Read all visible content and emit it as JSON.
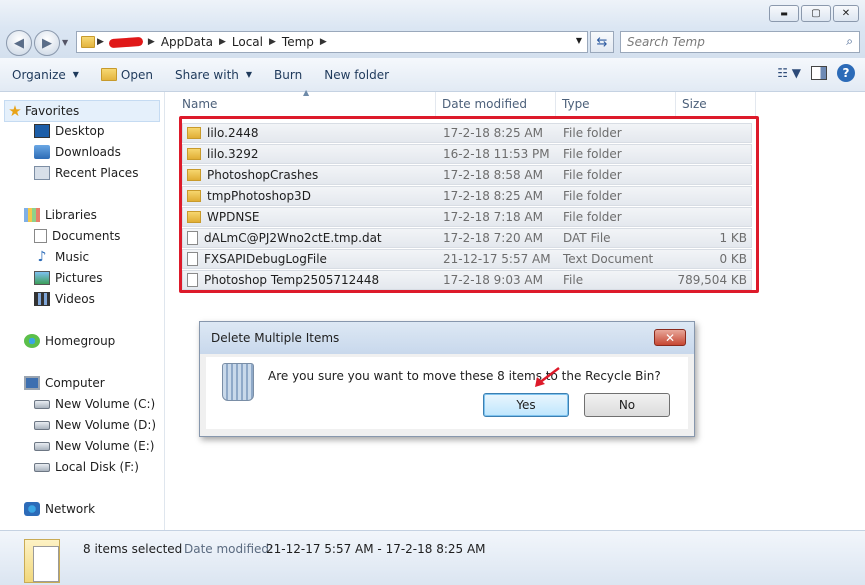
{
  "window": {
    "minimize": "▬",
    "maximize": "▢",
    "close": "✕"
  },
  "address": {
    "crumbs": [
      "AppData",
      "Local",
      "Temp"
    ],
    "search_placeholder": "Search Temp"
  },
  "toolbar": {
    "organize": "Organize",
    "open": "Open",
    "share_with": "Share with",
    "burn": "Burn",
    "new_folder": "New folder"
  },
  "nav": {
    "favorites": "Favorites",
    "desktop": "Desktop",
    "downloads": "Downloads",
    "recent_places": "Recent Places",
    "libraries": "Libraries",
    "documents": "Documents",
    "music": "Music",
    "pictures": "Pictures",
    "videos": "Videos",
    "homegroup": "Homegroup",
    "computer": "Computer",
    "drive_c": "New Volume (C:)",
    "drive_d": "New Volume (D:)",
    "drive_e": "New Volume (E:)",
    "drive_f": "Local Disk (F:)",
    "network": "Network"
  },
  "columns": {
    "name": "Name",
    "date": "Date modified",
    "type": "Type",
    "size": "Size"
  },
  "files": [
    {
      "name": "lilo.2448",
      "date": "17-2-18 8:25 AM",
      "type": "File folder",
      "size": "",
      "kind": "folder"
    },
    {
      "name": "lilo.3292",
      "date": "16-2-18 11:53 PM",
      "type": "File folder",
      "size": "",
      "kind": "folder"
    },
    {
      "name": "PhotoshopCrashes",
      "date": "17-2-18 8:58 AM",
      "type": "File folder",
      "size": "",
      "kind": "folder"
    },
    {
      "name": "tmpPhotoshop3D",
      "date": "17-2-18 8:25 AM",
      "type": "File folder",
      "size": "",
      "kind": "folder"
    },
    {
      "name": "WPDNSE",
      "date": "17-2-18 7:18 AM",
      "type": "File folder",
      "size": "",
      "kind": "folder"
    },
    {
      "name": "dALmC@PJ2Wno2ctE.tmp.dat",
      "date": "17-2-18 7:20 AM",
      "type": "DAT File",
      "size": "1 KB",
      "kind": "file"
    },
    {
      "name": "FXSAPIDebugLogFile",
      "date": "21-12-17 5:57 AM",
      "type": "Text Document",
      "size": "0 KB",
      "kind": "file"
    },
    {
      "name": "Photoshop Temp2505712448",
      "date": "17-2-18 9:03 AM",
      "type": "File",
      "size": "789,504 KB",
      "kind": "file"
    }
  ],
  "dialog": {
    "title": "Delete Multiple Items",
    "message": "Are you sure you want to move these 8 items to the Recycle Bin?",
    "yes": "Yes",
    "no": "No",
    "close": "✕"
  },
  "details": {
    "count": "8 items selected",
    "date_label": "Date modified:",
    "date_value": "21-12-17 5:57 AM - 17-2-18 8:25 AM"
  },
  "colors": {
    "highlight_red": "#dd1a2a",
    "accent_blue": "#2c6bb8"
  }
}
